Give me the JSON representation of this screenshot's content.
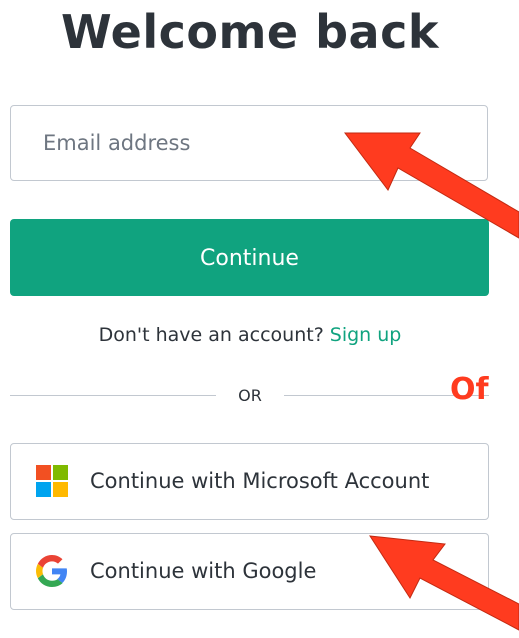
{
  "title": "Welcome back",
  "email": {
    "placeholder": "Email address",
    "value": ""
  },
  "continue_label": "Continue",
  "signup": {
    "prompt": "Don't have an account?",
    "link_label": "Sign up"
  },
  "divider_label": "OR",
  "annotation_text": "Of",
  "social": {
    "microsoft": {
      "label": "Continue with Microsoft Account",
      "icon": "microsoft-logo-icon"
    },
    "google": {
      "label": "Continue with Google",
      "icon": "google-logo-icon"
    }
  },
  "colors": {
    "accent": "#10a37f",
    "annotation": "#ff3b1f",
    "text": "#2d333a",
    "border": "#c2c8d0"
  }
}
